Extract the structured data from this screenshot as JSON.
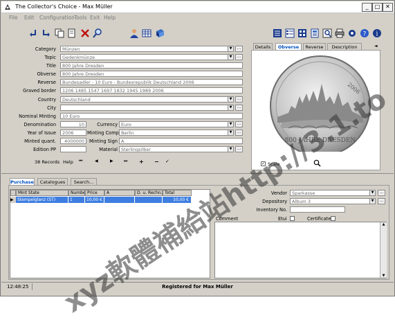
{
  "window": {
    "title": "The Collector's Choice - Max Müller",
    "minimize": "_",
    "maximize": "□",
    "close": "✕"
  },
  "menu": [
    "File",
    "Edit",
    "Configuration",
    "Tools",
    "Exit",
    "Help"
  ],
  "toolbar_left_icons": [
    "new-icon",
    "insert-icon",
    "copy-icon",
    "print-preview-icon",
    "delete-icon",
    "find-icon"
  ],
  "toolbar_mid_icons": [
    "user-icon",
    "table-icon",
    "book-icon"
  ],
  "toolbar_right_icons": [
    "list-view-icon",
    "detail-view-icon",
    "grid-view-icon",
    "report-icon",
    "zoom-icon",
    "printer-icon",
    "settings-icon",
    "help-icon",
    "info-icon"
  ],
  "form": {
    "category": {
      "label": "Category",
      "value": "Münzen"
    },
    "topic": {
      "label": "Topic",
      "value": "Gedenkmünze"
    },
    "title": {
      "label": "Title",
      "value": "800 Jahre Dresden"
    },
    "obverse": {
      "label": "Obverse",
      "value": "800 Jahre Dresden"
    },
    "reverse": {
      "label": "Reverse",
      "value": "Bundesadler - 10 Euro - Bundesrepublik Deutschland 2006"
    },
    "graved_border": {
      "label": "Graved border",
      "value": "1206 1485 1547 1697 1832 1945 1989 2006"
    },
    "country": {
      "label": "Country",
      "value": "Deutschland"
    },
    "city": {
      "label": "City",
      "value": ""
    },
    "nominal_minting": {
      "label": "Nominal Minting",
      "value": "10 Euro"
    },
    "denomination": {
      "label": "Denomination",
      "value": "10"
    },
    "currency": {
      "label": "Currency",
      "value": "Euro"
    },
    "year_of_issue": {
      "label": "Year of Issue",
      "value": "2006"
    },
    "minting_comp": {
      "label": "Minting Comp.",
      "value": "Berlin"
    },
    "minted_quant": {
      "label": "Minted quant.",
      "value": "4000000"
    },
    "minting_sign": {
      "label": "Minting Sign",
      "value": "A"
    },
    "edition_pp": {
      "label": "Edition PP",
      "value": ""
    },
    "material": {
      "label": "Material",
      "value": "Sterlingsilber"
    }
  },
  "nav": {
    "records": "38 Records",
    "help": "Help",
    "first": "⏮",
    "prev": "◀",
    "next": "▶",
    "last": "⏭",
    "add": "+",
    "remove": "−"
  },
  "image_tabs": {
    "details": "Details",
    "obverse": "Obverse",
    "reverse": "Reverse",
    "description": "Description"
  },
  "coin": {
    "top_text": "2006",
    "bottom_text": "800 JAHRE DRESDEN"
  },
  "scale": {
    "label": "Scale",
    "checked": true
  },
  "bottom_tabs": {
    "purchase": "Purchase",
    "catalogues": "Catalogues",
    "search": "Search..."
  },
  "grid": {
    "headers": [
      "Mint State",
      "Numbe",
      "Price",
      "A",
      "D. u. Rechn.",
      "Total"
    ],
    "rows": [
      [
        "Stempelglanz (ST)",
        "1",
        "10,00 €",
        "",
        "",
        "10,00 €"
      ]
    ]
  },
  "purchase": {
    "vendor": {
      "label": "Vendor",
      "value": "Sparkasse"
    },
    "depository": {
      "label": "Depository",
      "value": "Album 3"
    },
    "inventory": {
      "label": "Inventory No.",
      "value": ""
    },
    "comment_label": "Comment",
    "etui_label": "Etui",
    "certificate_label": "Certificate"
  },
  "status": {
    "time": "12:48:25",
    "registered": "Registered for Max Müller"
  },
  "watermark": {
    "diagonal": "xyz軟體補給站http://3.1.to"
  },
  "colors": {
    "selection": "#3e7ee0",
    "active_tab": "#0050c0",
    "window_bg": "#d4d0c8"
  }
}
